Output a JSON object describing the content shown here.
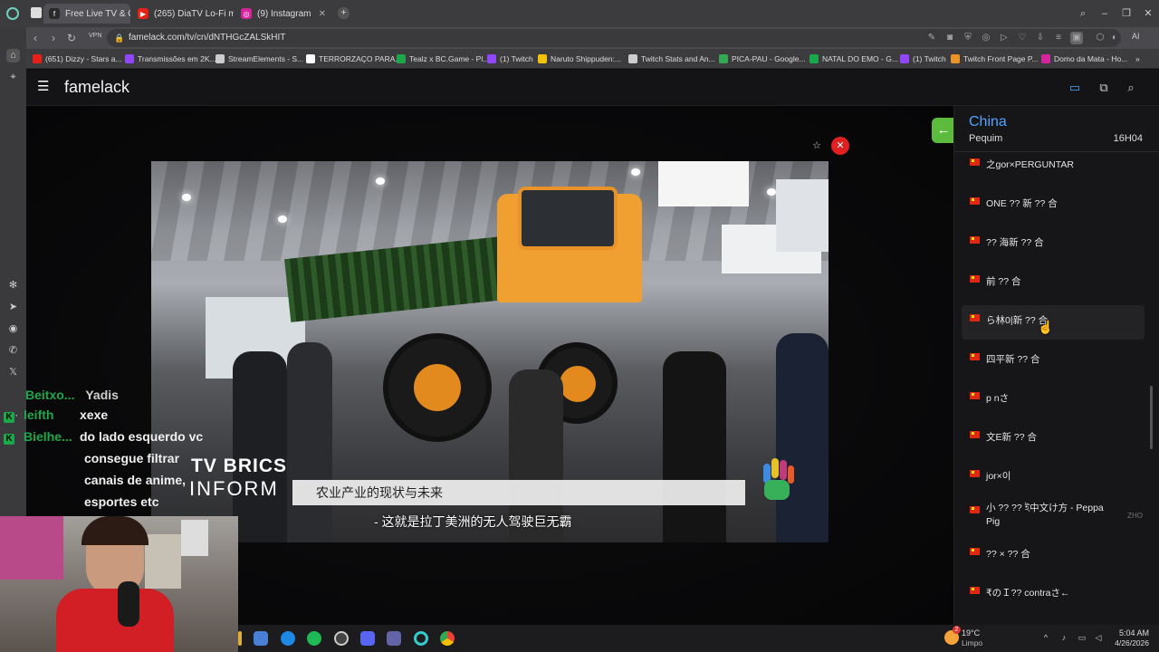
{
  "browser": {
    "tabs": [
      {
        "label": "Free Live TV & Onl",
        "icon": "famelack-icon",
        "color": "#2a2a2a"
      },
      {
        "label": "(265) DiaTV Lo-Fi música",
        "icon": "youtube-icon",
        "color": "#e62117"
      },
      {
        "label": "(9) Instagram",
        "icon": "instagram-icon",
        "color": "#d6249f"
      }
    ],
    "vpn_label": "VPN",
    "url": "famelack.com/tv/cn/dNTHGcZALSkHIT",
    "ai_label": "AI",
    "bookmarks": [
      {
        "label": "(651) Dizzy - Stars a...",
        "color": "#e62117"
      },
      {
        "label": "Transmissões em 2K...",
        "color": "#9146ff"
      },
      {
        "label": "StreamElements - S...",
        "color": "#cccccc"
      },
      {
        "label": "TERRORZAÇO PARA...",
        "color": "#ffffff"
      },
      {
        "label": "Tealz x BC.Game - Pl...",
        "color": "#19a84a"
      },
      {
        "label": "(1) Twitch",
        "color": "#9146ff"
      },
      {
        "label": "Naruto Shippuden:...",
        "color": "#f2c200"
      },
      {
        "label": "Twitch Stats and An...",
        "color": "#cccccc"
      },
      {
        "label": "PICA-PAU - Google...",
        "color": "#34a853"
      },
      {
        "label": "NATAL DO EMO - G...",
        "color": "#19a84a"
      },
      {
        "label": "(1) Twitch",
        "color": "#9146ff"
      },
      {
        "label": "Twitch Front Page P...",
        "color": "#e8922a"
      },
      {
        "label": "Domo da Mata - Ho...",
        "color": "#d6249f"
      }
    ]
  },
  "app": {
    "brand": "famelack"
  },
  "video": {
    "logo_line1": "TV BRICS",
    "logo_line2": "INFORM",
    "lower_third": "农业产业的现状与未来",
    "subtitle": "- 这就是拉丁美洲的无人驾驶巨无霸"
  },
  "chat": [
    {
      "user": "leifth",
      "message": "xexe",
      "user_color": "#19a84a"
    },
    {
      "user": "Bielhe...",
      "message": "do lado esquerdo vc",
      "user_color": "#19a84a"
    },
    {
      "user": "",
      "message": "consegue filtrar",
      "user_color": "#19a84a"
    },
    {
      "user": "",
      "message": "canais de anime,",
      "user_color": "#19a84a"
    },
    {
      "user": "",
      "message": "esportes etc",
      "user_color": "#19a84a"
    }
  ],
  "panel": {
    "country": "China",
    "city": "Pequim",
    "time": "16H04",
    "channels": [
      {
        "name": "之gor×PERGUNTAR",
        "tag": ""
      },
      {
        "name": "ONE ?? 新 ?? 合",
        "tag": ""
      },
      {
        "name": "?? 海新 ?? 合",
        "tag": ""
      },
      {
        "name": "前 ?? 合",
        "tag": ""
      },
      {
        "name": "ら林0|新 ?? 合",
        "tag": ""
      },
      {
        "name": "四平新 ?? 合",
        "tag": ""
      },
      {
        "name": "p nさ",
        "tag": ""
      },
      {
        "name": "文E新 ?? 合",
        "tag": ""
      },
      {
        "name": "jor×이",
        "tag": ""
      },
      {
        "name": "小 ?? ?? ই中文け方 - Peppa Pig",
        "tag": "ZHO"
      },
      {
        "name": "?? × ?? 合",
        "tag": ""
      },
      {
        "name": "₹のＩ?? contraさ←",
        "tag": ""
      }
    ]
  },
  "taskbar": {
    "temperature": "19°C",
    "weather": "Limpo",
    "weather_badge": "2",
    "clock": "5:04 AM",
    "date": "4/26/2026"
  }
}
